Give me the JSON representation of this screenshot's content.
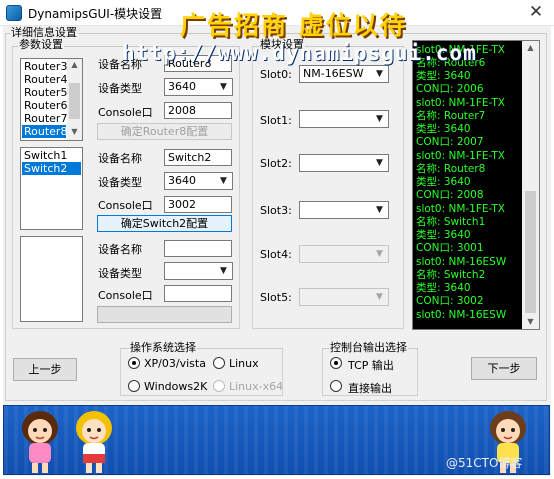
{
  "window": {
    "title": "DynamipsGUI-模块设置",
    "close_glyph": "✕"
  },
  "details_group": {
    "legend": "详细信息设置"
  },
  "params_group": {
    "legend": "参数设置"
  },
  "router_list": {
    "items": [
      "Router3",
      "Router4",
      "Router5",
      "Router6",
      "Router7",
      "Router8"
    ],
    "selected_index": 5
  },
  "switch_list": {
    "items": [
      "Switch1",
      "Switch2"
    ],
    "selected_index": 1
  },
  "device_panel_1": {
    "name_label": "设备名称",
    "name_value": "Router8",
    "type_label": "设备类型",
    "type_value": "3640",
    "console_label": "Console口",
    "console_value": "2008",
    "confirm_label": "确定Router8配置"
  },
  "device_panel_2": {
    "name_label": "设备名称",
    "name_value": "Switch2",
    "type_label": "设备类型",
    "type_value": "3640",
    "console_label": "Console口",
    "console_value": "3002",
    "confirm_label": "确定Switch2配置"
  },
  "device_panel_3": {
    "name_label": "设备名称",
    "name_value": "",
    "type_label": "设备类型",
    "type_value": "",
    "console_label": "Console口",
    "console_value": "",
    "confirm_label": ""
  },
  "module_group": {
    "legend": "模块设置",
    "slots": [
      {
        "label": "Slot0:",
        "value": "NM-16ESW",
        "enabled": true
      },
      {
        "label": "Slot1:",
        "value": "",
        "enabled": true
      },
      {
        "label": "Slot2:",
        "value": "",
        "enabled": true
      },
      {
        "label": "Slot3:",
        "value": "",
        "enabled": true
      },
      {
        "label": "Slot4:",
        "value": "",
        "enabled": false
      },
      {
        "label": "Slot5:",
        "value": "",
        "enabled": false
      }
    ]
  },
  "console_output": {
    "lines": [
      "slot0: NM-1FE-TX",
      "名称: Router6",
      "类型: 3640",
      "CON口: 2006",
      "slot0: NM-1FE-TX",
      "名称: Router7",
      "类型: 3640",
      "CON口: 2007",
      "slot0: NM-1FE-TX",
      "名称: Router8",
      "类型: 3640",
      "CON口: 2008",
      "slot0: NM-1FE-TX",
      "名称: Switch1",
      "类型: 3640",
      "CON口: 3001",
      "slot0: NM-16ESW",
      "名称: Switch2",
      "类型: 3640",
      "CON口: 3002",
      "slot0: NM-16ESW"
    ],
    "text_color": "#2aff2a"
  },
  "os_group": {
    "legend": "操作系统选择",
    "options": [
      "XP/03/vista",
      "Linux",
      "Windows2K",
      "Linux-x64"
    ],
    "selected": "XP/03/vista"
  },
  "output_group": {
    "legend": "控制台输出选择",
    "options": [
      "TCP 输出",
      "直接输出"
    ],
    "selected": "TCP 输出"
  },
  "buttons": {
    "prev": "上一步",
    "next": "下一步"
  },
  "banner": {
    "slogan": "广告招商 虚位以待",
    "url": "http://www.dynamipsgui.com",
    "watermark": "@51CTO博客"
  },
  "colors": {
    "selection": "#0078d7",
    "banner_blue": "#1d63c7",
    "slogan_yellow": "#ffd200"
  }
}
